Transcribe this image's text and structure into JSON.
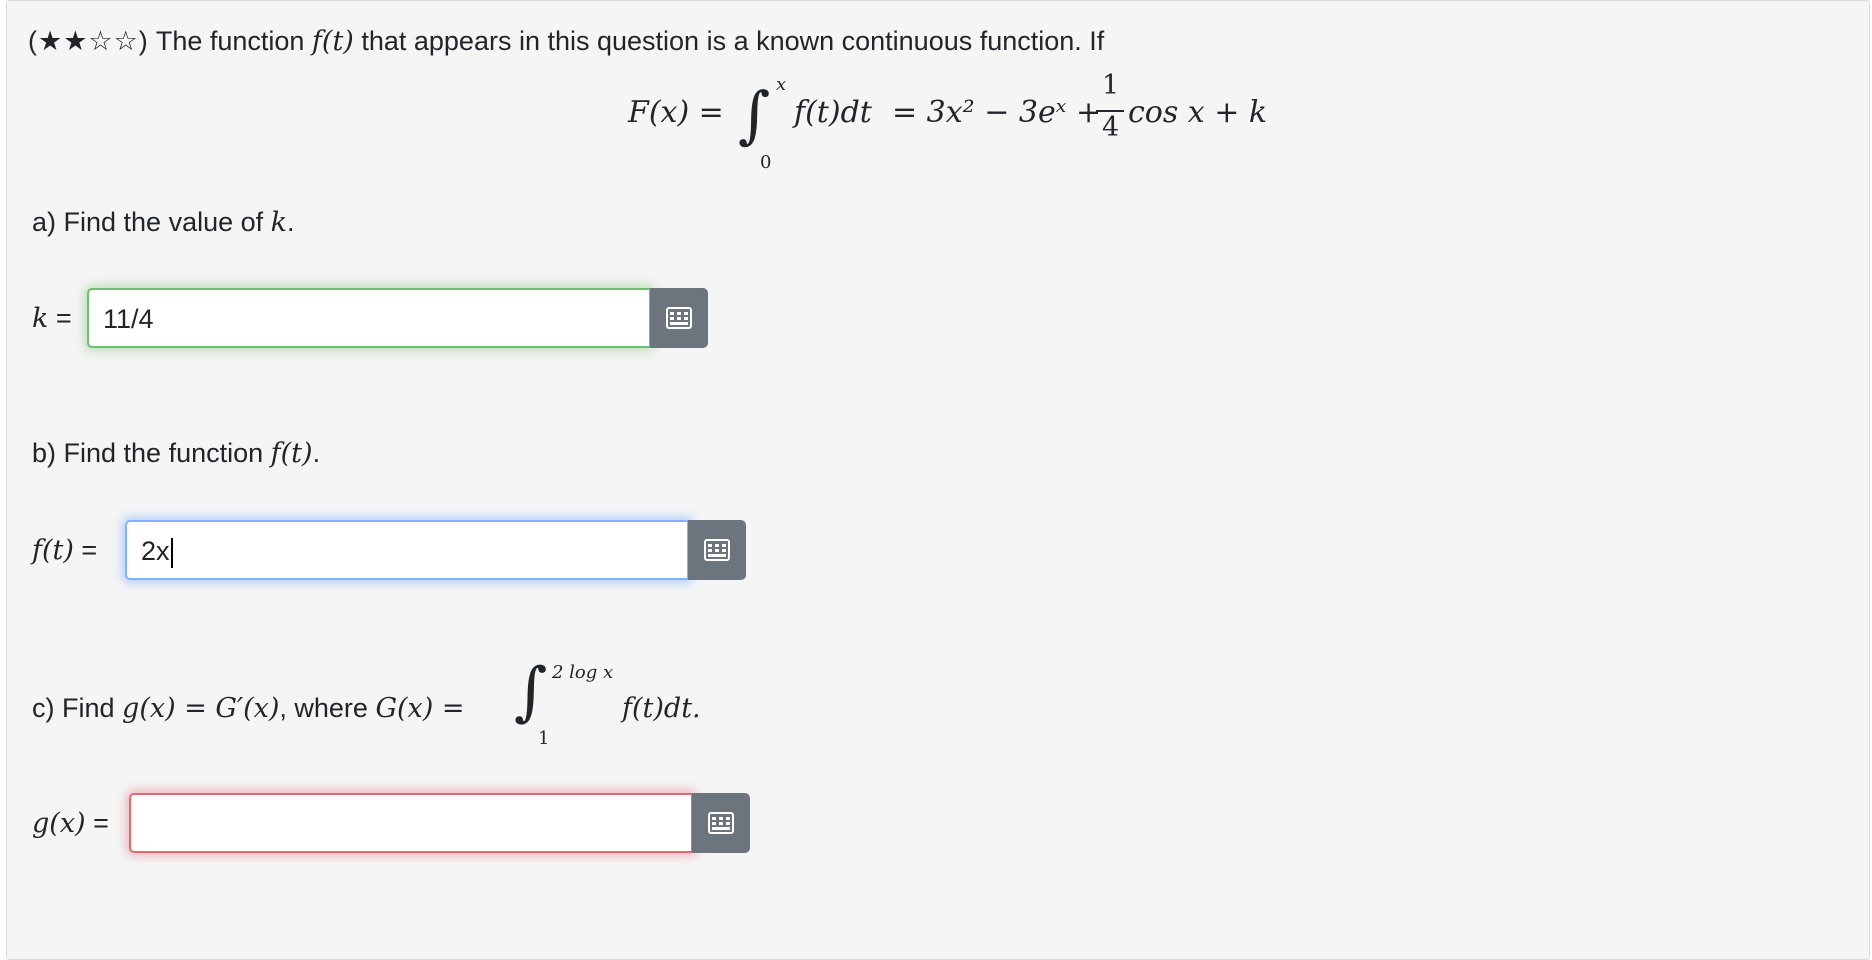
{
  "header": {
    "difficulty_stars": "(★★☆☆)",
    "text_before": " The function ",
    "func_var": "f(t)",
    "text_after": " that appears in this question is a known continuous function. If"
  },
  "formula": {
    "lhs": "F(x) =",
    "int_upper": "x",
    "int_lower": "0",
    "integrand": "f(t)dt",
    "mid": "= 3x² − 3eˣ +",
    "frac_num": "1",
    "frac_den": "4",
    "tail": "cos x + k"
  },
  "part_a": {
    "prompt_prefix": "a) Find the value of ",
    "prompt_var": "k",
    "prompt_suffix": ".",
    "input_label_var": "k",
    "input_label_eq": " =",
    "value": "11/4",
    "status": "correct"
  },
  "part_b": {
    "prompt_prefix": "b) Find the function ",
    "prompt_var": "f(t)",
    "prompt_suffix": ".",
    "input_label_var": "f(t)",
    "input_label_eq": " =",
    "value": "2x",
    "status": "focused"
  },
  "part_c": {
    "prompt_prefix": "c) Find ",
    "prompt_math1": "g(x) = G′(x)",
    "prompt_mid": ", where ",
    "prompt_math2": "G(x) =",
    "int_upper": "2 log x",
    "int_lower": "1",
    "integrand": "f(t)dt.",
    "input_label_var": "g(x)",
    "input_label_eq": " =",
    "value": "",
    "status": "incorrect"
  },
  "icons": {
    "keypad": "keypad-grid-icon"
  },
  "colors": {
    "correct": "#6fbf73",
    "focused": "#80b3ff",
    "incorrect": "#e06a74",
    "button": "#6c757d"
  }
}
